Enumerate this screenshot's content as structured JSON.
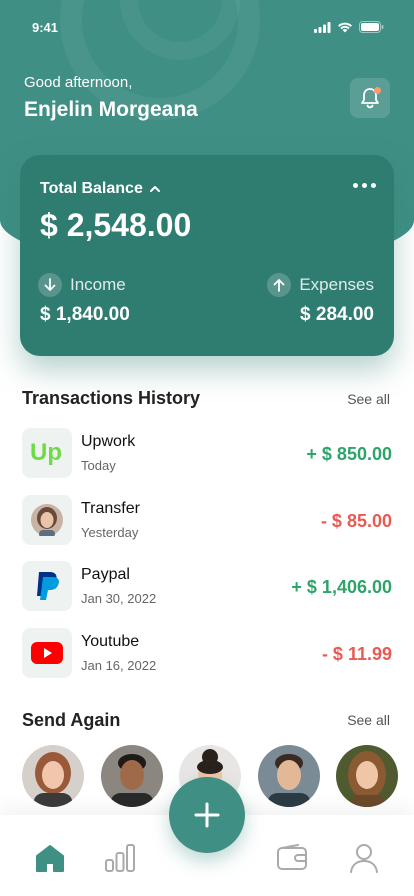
{
  "colors": {
    "brand": "#3f8f84",
    "card": "#2f7c71",
    "positive": "#2ea36a",
    "negative": "#e85a52"
  },
  "status_bar": {
    "time": "9:41"
  },
  "header": {
    "greeting": "Good afternoon,",
    "user_name": "Enjelin Morgeana",
    "bell_icon": "bell-icon"
  },
  "balance": {
    "title": "Total Balance",
    "amount": "$ 2,548.00",
    "income_label": "Income",
    "income_value": "$ 1,840.00",
    "expenses_label": "Expenses",
    "expenses_value": "$ 284.00"
  },
  "transactions": {
    "title": "Transactions History",
    "see_all": "See all",
    "items": [
      {
        "name": "Upwork",
        "date": "Today",
        "amount": "+ $ 850.00",
        "type": "income"
      },
      {
        "name": "Transfer",
        "date": "Yesterday",
        "amount": "- $ 85.00",
        "type": "expense"
      },
      {
        "name": "Paypal",
        "date": "Jan 30, 2022",
        "amount": "+ $ 1,406.00",
        "type": "income"
      },
      {
        "name": "Youtube",
        "date": "Jan 16, 2022",
        "amount": "- $ 11.99",
        "type": "expense"
      }
    ]
  },
  "send_again": {
    "title": "Send Again",
    "see_all": "See all"
  },
  "upwork_logo_text": "Up",
  "tabs": [
    "home-icon",
    "stats-icon",
    "wallet-icon",
    "profile-icon"
  ]
}
